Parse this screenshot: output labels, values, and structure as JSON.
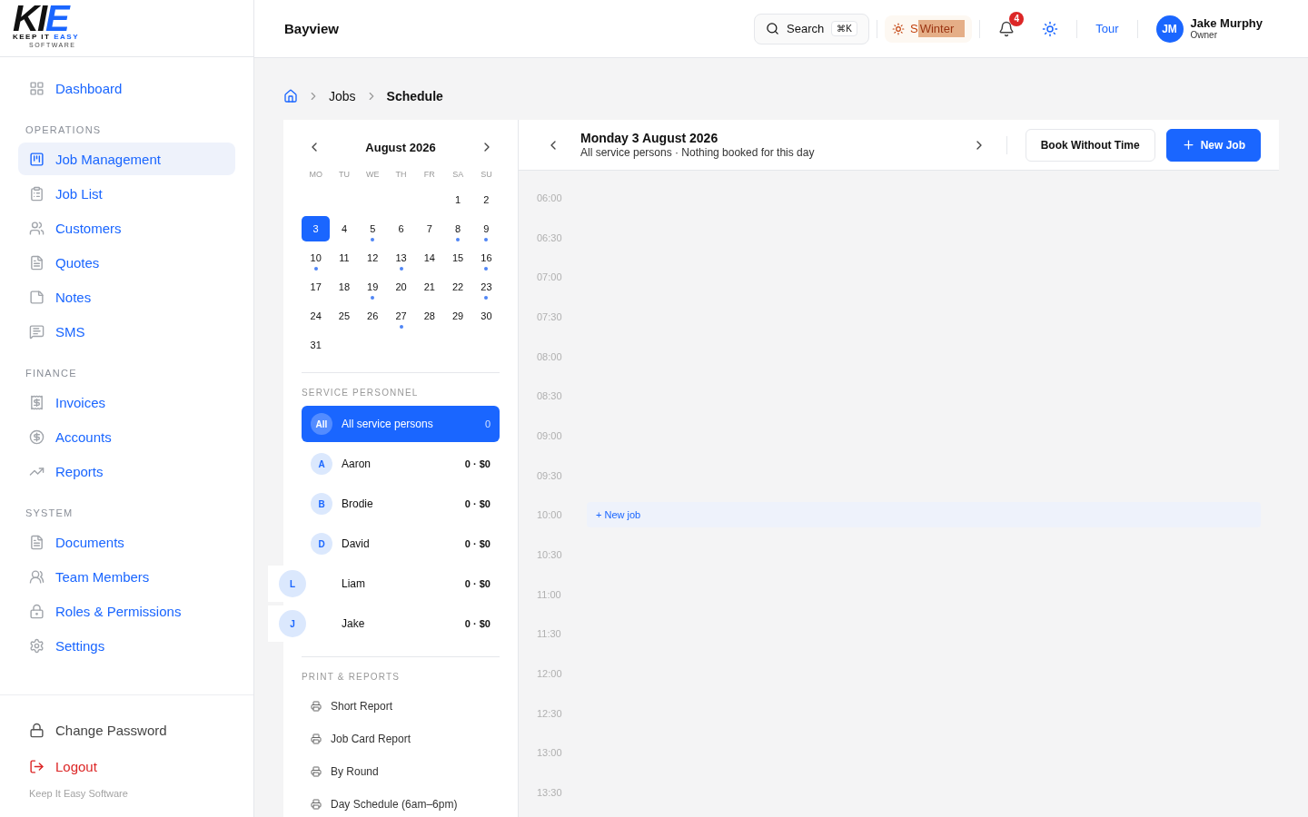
{
  "logo": {
    "mark_left": "KI",
    "mark_right": "E",
    "tagline_left": "KEEP IT ",
    "tagline_right": "EASY",
    "subline": "SOFTWARE"
  },
  "sidebar": {
    "top_items": [
      {
        "label": "Dashboard",
        "selected": false
      }
    ],
    "sections": [
      {
        "title": "OPERATIONS",
        "items": [
          {
            "label": "Job Management",
            "selected": true
          },
          {
            "label": "Job List",
            "selected": false
          },
          {
            "label": "Customers",
            "selected": false
          },
          {
            "label": "Quotes",
            "selected": false
          },
          {
            "label": "Notes",
            "selected": false
          },
          {
            "label": "SMS",
            "selected": false
          }
        ]
      },
      {
        "title": "FINANCE",
        "items": [
          {
            "label": "Invoices",
            "selected": false
          },
          {
            "label": "Accounts",
            "selected": false
          },
          {
            "label": "Reports",
            "selected": false
          }
        ]
      },
      {
        "title": "SYSTEM",
        "items": [
          {
            "label": "Documents",
            "selected": false
          },
          {
            "label": "Team Members",
            "selected": false
          },
          {
            "label": "Roles & Permissions",
            "selected": false
          },
          {
            "label": "Settings",
            "selected": false
          }
        ]
      }
    ],
    "footer_items": [
      {
        "label": "Change Password",
        "kind": "plain"
      },
      {
        "label": "Logout",
        "kind": "danger"
      }
    ],
    "copyright": "Keep It Easy Software"
  },
  "header": {
    "title": "Bayview",
    "search": {
      "label": "Search",
      "shortcut": "⌘K"
    },
    "season": {
      "hidden_text": "S",
      "label": "Winter"
    },
    "notifications": "4",
    "tour": "Tour",
    "user": {
      "initials": "JM",
      "name": "Jake Murphy",
      "role": "Owner"
    }
  },
  "breadcrumbs": [
    {
      "label": "Jobs"
    },
    {
      "label": "Schedule"
    }
  ],
  "calendar": {
    "month": "August 2026",
    "weekdays": [
      "MO",
      "TU",
      "WE",
      "TH",
      "FR",
      "SA",
      "SU"
    ],
    "weeks": [
      [
        {
          "day": "1",
          "selected": false,
          "has_jobs": false
        },
        {
          "day": "2",
          "selected": false,
          "has_jobs": false
        }
      ],
      [
        {
          "day": "3",
          "selected": true,
          "has_jobs": false
        },
        {
          "day": "4",
          "selected": false,
          "has_jobs": false
        },
        {
          "day": "5",
          "selected": false,
          "has_jobs": true
        },
        {
          "day": "6",
          "selected": false,
          "has_jobs": false
        },
        {
          "day": "7",
          "selected": false,
          "has_jobs": false
        },
        {
          "day": "8",
          "selected": false,
          "has_jobs": true
        },
        {
          "day": "9",
          "selected": false,
          "has_jobs": true
        }
      ],
      [
        {
          "day": "10",
          "selected": false,
          "has_jobs": true
        },
        {
          "day": "11",
          "selected": false,
          "has_jobs": false
        },
        {
          "day": "12",
          "selected": false,
          "has_jobs": false
        },
        {
          "day": "13",
          "selected": false,
          "has_jobs": true
        },
        {
          "day": "14",
          "selected": false,
          "has_jobs": false
        },
        {
          "day": "15",
          "selected": false,
          "has_jobs": false
        },
        {
          "day": "16",
          "selected": false,
          "has_jobs": true
        }
      ],
      [
        {
          "day": "17",
          "selected": false,
          "has_jobs": false
        },
        {
          "day": "18",
          "selected": false,
          "has_jobs": false
        },
        {
          "day": "19",
          "selected": false,
          "has_jobs": true
        },
        {
          "day": "20",
          "selected": false,
          "has_jobs": false
        },
        {
          "day": "21",
          "selected": false,
          "has_jobs": false
        },
        {
          "day": "22",
          "selected": false,
          "has_jobs": false
        },
        {
          "day": "23",
          "selected": false,
          "has_jobs": true
        }
      ],
      [
        {
          "day": "24",
          "selected": false,
          "has_jobs": false
        },
        {
          "day": "25",
          "selected": false,
          "has_jobs": false
        },
        {
          "day": "26",
          "selected": false,
          "has_jobs": false
        },
        {
          "day": "27",
          "selected": false,
          "has_jobs": true
        },
        {
          "day": "28",
          "selected": false,
          "has_jobs": false
        },
        {
          "day": "29",
          "selected": false,
          "has_jobs": false
        },
        {
          "day": "30",
          "selected": false,
          "has_jobs": false
        }
      ],
      [
        {
          "day": "31",
          "selected": false,
          "has_jobs": false
        }
      ]
    ]
  },
  "personnel": {
    "title": "SERVICE PERSONNEL",
    "items": [
      {
        "initials": "All",
        "name": "All service persons",
        "stat": "0",
        "selected": true,
        "avatar_offset": false
      },
      {
        "initials": "A",
        "name": "Aaron",
        "stat": "0 · $0",
        "selected": false,
        "avatar_offset": false
      },
      {
        "initials": "B",
        "name": "Brodie",
        "stat": "0 · $0",
        "selected": false,
        "avatar_offset": false
      },
      {
        "initials": "D",
        "name": "David",
        "stat": "0 · $0",
        "selected": false,
        "avatar_offset": false
      },
      {
        "initials": "L",
        "name": "Liam",
        "stat": "0 · $0",
        "selected": false,
        "avatar_offset": true
      },
      {
        "initials": "J",
        "name": "Jake",
        "stat": "0 · $0",
        "selected": false,
        "avatar_offset": true
      }
    ]
  },
  "reports": {
    "title": "PRINT & REPORTS",
    "items": [
      "Short Report",
      "Job Card Report",
      "By Round",
      "Day Schedule (6am–6pm)"
    ]
  },
  "schedule": {
    "date": "Monday 3 August 2026",
    "subtitle": "All service persons · Nothing booked for this day",
    "book_button": "Book Without Time",
    "new_button": "New Job",
    "slots": [
      {
        "time": "06:00"
      },
      {
        "time": "06:30"
      },
      {
        "time": "07:00"
      },
      {
        "time": "07:30"
      },
      {
        "time": "08:00"
      },
      {
        "time": "08:30"
      },
      {
        "time": "09:00"
      },
      {
        "time": "09:30"
      },
      {
        "time": "10:00",
        "action": "+ New job"
      },
      {
        "time": "10:30"
      },
      {
        "time": "11:00"
      },
      {
        "time": "11:30"
      },
      {
        "time": "12:00"
      },
      {
        "time": "12:30"
      },
      {
        "time": "13:00"
      },
      {
        "time": "13:30"
      }
    ]
  }
}
